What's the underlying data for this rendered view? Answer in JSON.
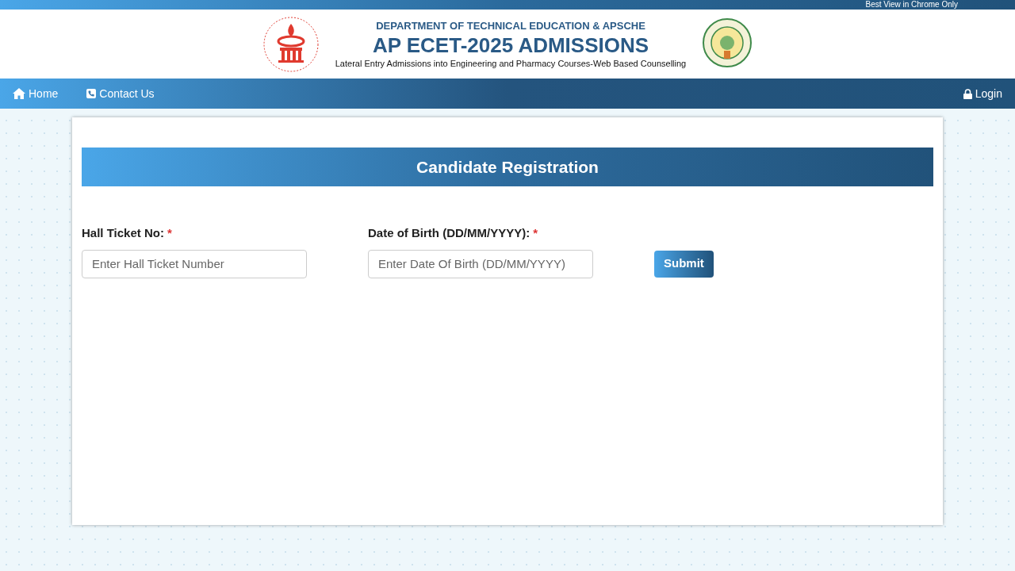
{
  "top_bar": {
    "notice": "Best View in Chrome Only"
  },
  "header": {
    "department": "DEPARTMENT OF TECHNICAL EDUCATION & APSCHE",
    "title": "AP ECET-2025 ADMISSIONS",
    "subtitle": "Lateral Entry Admissions into Engineering and Pharmacy Courses-Web Based Counselling"
  },
  "nav": {
    "items": [
      {
        "label": "Home",
        "kind": "home"
      },
      {
        "label": "Contact Us",
        "kind": "phone"
      }
    ],
    "login": "Login"
  },
  "form": {
    "heading": "Candidate Registration",
    "fields": [
      {
        "label": "Hall Ticket No:",
        "required_mark": "*",
        "placeholder": "Enter Hall Ticket Number"
      },
      {
        "label": "Date of Birth (DD/MM/YYYY):",
        "required_mark": "*",
        "placeholder": "Enter Date Of Birth (DD/MM/YYYY)"
      }
    ],
    "submit": "Submit"
  }
}
